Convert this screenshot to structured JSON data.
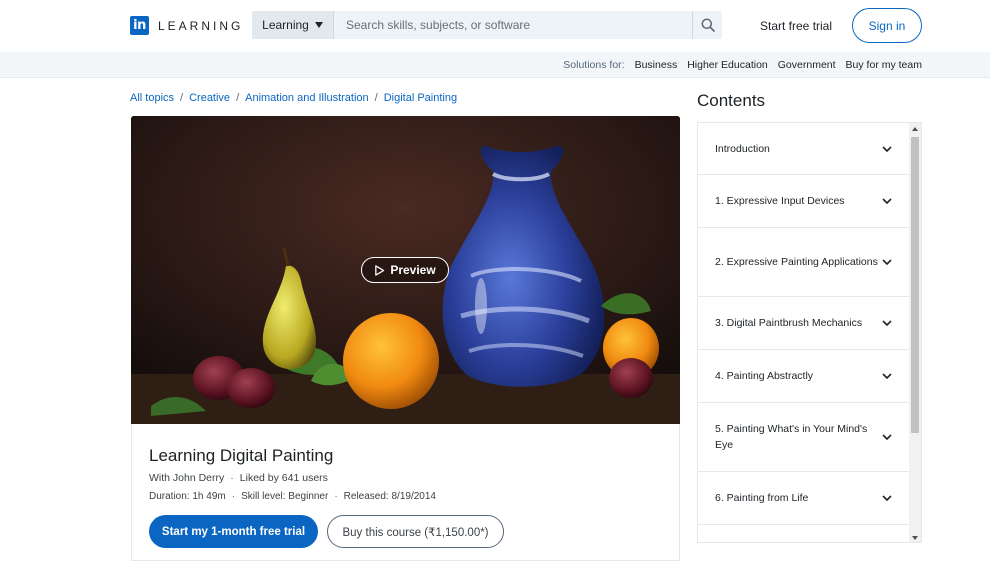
{
  "header": {
    "logo_mark": "in",
    "logo_text": "LEARNING",
    "search_select": "Learning",
    "search_placeholder": "Search skills, subjects, or software",
    "trial_link": "Start free trial",
    "signin": "Sign in"
  },
  "solutions": {
    "label": "Solutions for:",
    "items": [
      "Business",
      "Higher Education",
      "Government",
      "Buy for my team"
    ]
  },
  "breadcrumb": {
    "items": [
      "All topics",
      "Creative",
      "Animation and Illustration",
      "Digital Painting"
    ],
    "separator": "/"
  },
  "video": {
    "preview_label": "Preview"
  },
  "course": {
    "title": "Learning Digital Painting",
    "author": "With John Derry",
    "likes": "Liked by 641 users",
    "duration": "Duration: 1h 49m",
    "skill": "Skill level: Beginner",
    "released": "Released: 8/19/2014",
    "dot": "·",
    "primary_cta": "Start my 1-month free trial",
    "secondary_cta": "Buy this course (₹1,150.00*)"
  },
  "contents": {
    "title": "Contents",
    "chapters": [
      "Introduction",
      "1. Expressive Input Devices",
      "2. Expressive Painting Applications",
      "3. Digital Paintbrush Mechanics",
      "4. Painting Abstractly",
      "5. Painting What's in Your Mind's Eye",
      "6. Painting from Life"
    ]
  },
  "colors": {
    "brand": "#0a66c2",
    "text": "#1d2226"
  }
}
